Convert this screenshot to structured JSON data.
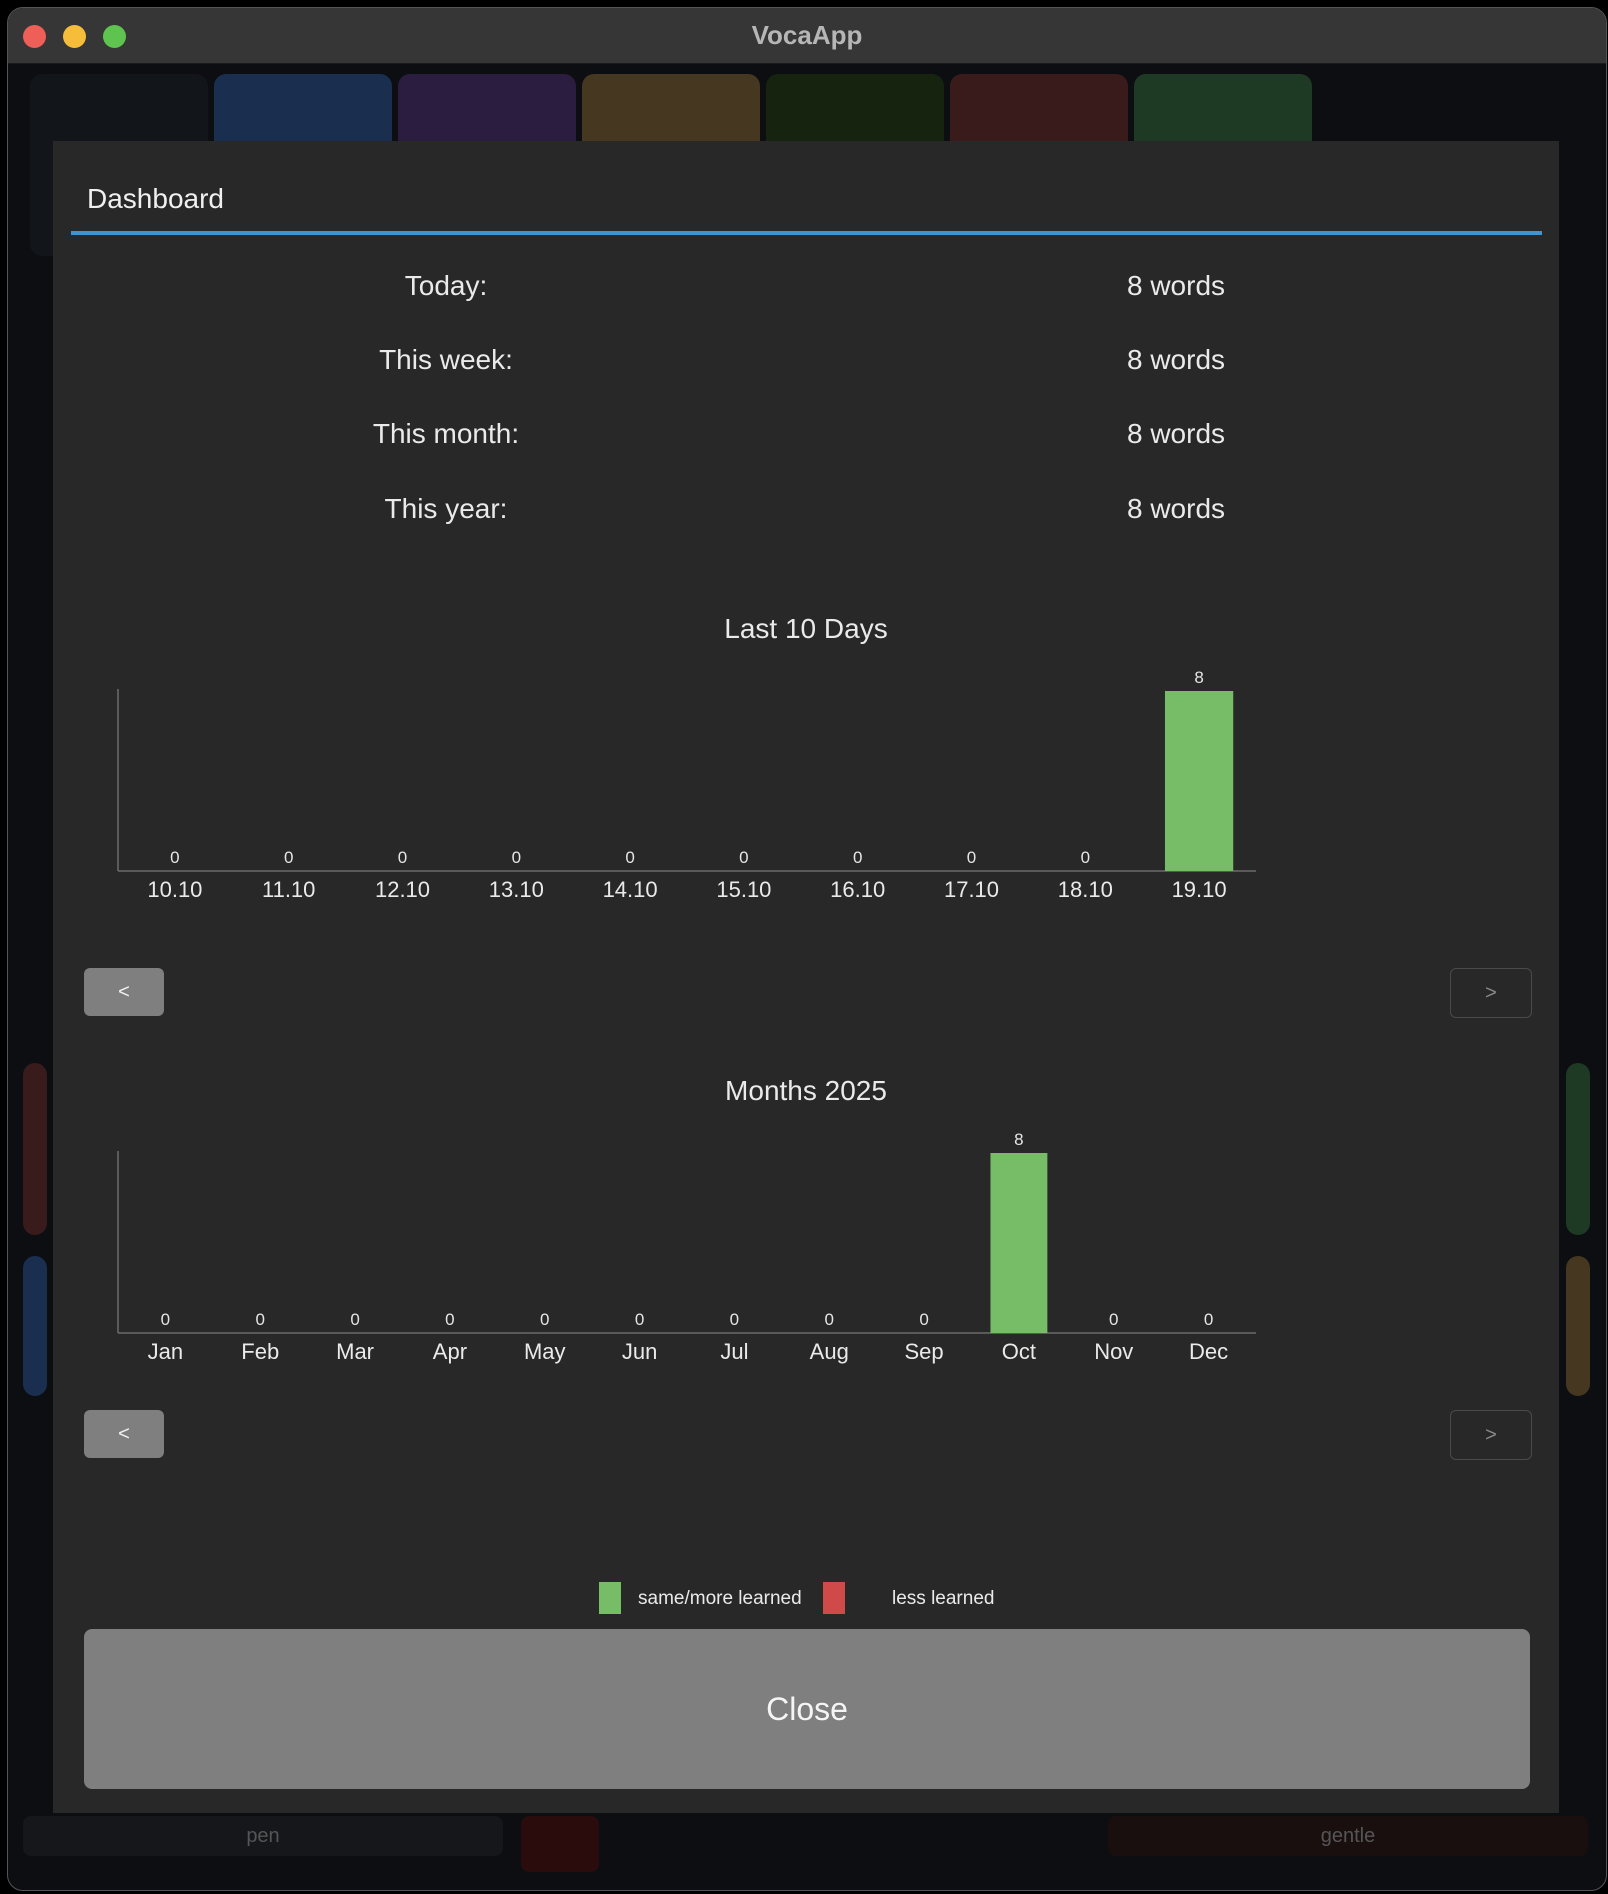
{
  "window": {
    "title": "VocaApp"
  },
  "dialog": {
    "title": "Dashboard",
    "stats": [
      {
        "label": "Today:",
        "value": "8 words"
      },
      {
        "label": "This week:",
        "value": "8 words"
      },
      {
        "label": "This month:",
        "value": "8 words"
      },
      {
        "label": "This year:",
        "value": "8 words"
      }
    ],
    "nav": {
      "prev_label": "<",
      "next_label": ">"
    },
    "legend": {
      "more_label": "same/more learned",
      "less_label": "less learned",
      "more_color": "#77bd67",
      "less_color": "#cf4a48"
    },
    "close_label": "Close"
  },
  "background": {
    "tile_colors": [
      "#121519",
      "#1a2e4f",
      "#2a1d40",
      "#463720",
      "#15230f",
      "#3a1b1b",
      "#1e3a25"
    ],
    "row_left_label": "pen",
    "row_right_label": "gentle"
  },
  "chart_data": [
    {
      "type": "bar",
      "title": "Last 10 Days",
      "categories": [
        "10.10",
        "11.10",
        "12.10",
        "13.10",
        "14.10",
        "15.10",
        "16.10",
        "17.10",
        "18.10",
        "19.10"
      ],
      "values": [
        0,
        0,
        0,
        0,
        0,
        0,
        0,
        0,
        0,
        8
      ],
      "ylim": [
        0,
        8
      ],
      "bar_color": "#77bd67",
      "grid": false
    },
    {
      "type": "bar",
      "title": "Months 2025",
      "categories": [
        "Jan",
        "Feb",
        "Mar",
        "Apr",
        "May",
        "Jun",
        "Jul",
        "Aug",
        "Sep",
        "Oct",
        "Nov",
        "Dec"
      ],
      "values": [
        0,
        0,
        0,
        0,
        0,
        0,
        0,
        0,
        0,
        8,
        0,
        0
      ],
      "ylim": [
        0,
        8
      ],
      "bar_color": "#77bd67",
      "grid": false
    }
  ]
}
